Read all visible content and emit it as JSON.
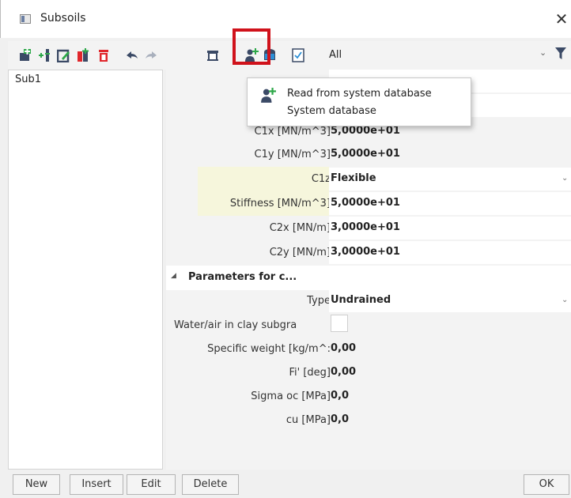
{
  "window": {
    "title": "Subsoils",
    "close_glyph": "✕"
  },
  "toolbar": {
    "icons": [
      "new-icon",
      "insert-icon",
      "edit-icon",
      "copy-icon",
      "delete-icon",
      "undo-icon",
      "redo-icon",
      "library-icon",
      "read-from-database-icon",
      "save-to-database-icon",
      "check-icon"
    ],
    "filter_value": "All",
    "filter_chevron": "⌄",
    "highlight_color": "#d0121b"
  },
  "list": {
    "items": [
      "Sub1"
    ]
  },
  "properties": {
    "rows": [
      {
        "label": "C1x [MN/m^3]",
        "value": "5,0000e+01"
      },
      {
        "label": "C1y [MN/m^3]",
        "value": "5,0000e+01"
      },
      {
        "label": "C1z",
        "value": "Flexible"
      },
      {
        "label": "Stiffness [MN/m^3]",
        "value": "5,0000e+01"
      },
      {
        "label": "C2x [MN/m]",
        "value": "3,0000e+01"
      },
      {
        "label": "C2y [MN/m]",
        "value": "3,0000e+01"
      }
    ],
    "group": {
      "title": "Parameters for c...",
      "caret": "◢"
    },
    "group_rows": [
      {
        "label": "Type",
        "value": "Undrained"
      },
      {
        "label": "Water/air in clay subgra",
        "value": ""
      },
      {
        "label": "Specific weight [kg/m^:",
        "value": "0,00"
      },
      {
        "label": "Fi' [deg]",
        "value": "0,00"
      },
      {
        "label": "Sigma oc [MPa]",
        "value": "0,0"
      },
      {
        "label": "cu [MPa]",
        "value": "0,0"
      }
    ],
    "dropdown_chevron": "⌄",
    "highlight_color": "#f6f6dc"
  },
  "popup": {
    "line1": "Read from system database",
    "line2": "System database"
  },
  "buttons": {
    "new": "New",
    "insert": "Insert",
    "edit": "Edit",
    "delete": "Delete",
    "ok": "OK"
  }
}
